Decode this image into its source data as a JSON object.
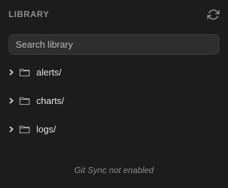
{
  "library": {
    "title": "LIBRARY",
    "refresh_icon": "refresh-icon"
  },
  "search": {
    "placeholder": "Search library",
    "value": ""
  },
  "folders": [
    {
      "label": "alerts/",
      "icon": "folder-icon",
      "expanded": false
    },
    {
      "label": "charts/",
      "icon": "folder-icon",
      "expanded": false
    },
    {
      "label": "logs/",
      "icon": "folder-icon",
      "expanded": false
    }
  ],
  "footer": {
    "status": "Git Sync not enabled"
  },
  "colors": {
    "background": "#1c1c1c",
    "search_bg": "#2e2e2e",
    "text": "#e4e4e4",
    "muted": "#8f8f8f"
  }
}
